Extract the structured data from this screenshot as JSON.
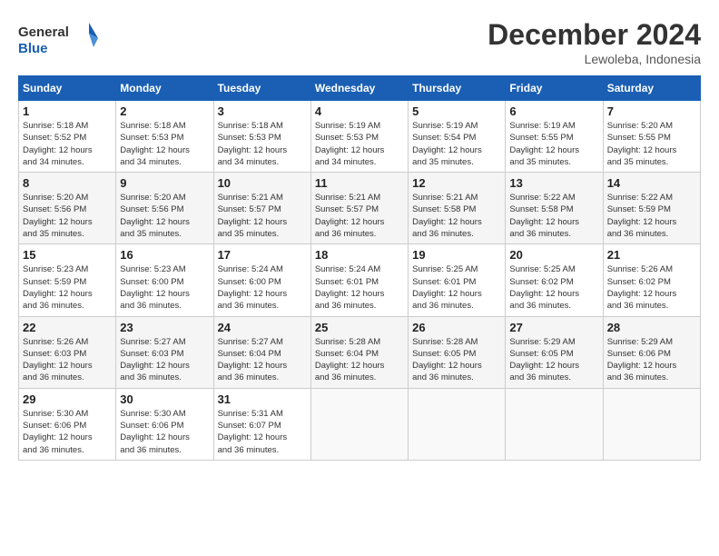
{
  "logo": {
    "line1": "General",
    "line2": "Blue"
  },
  "title": "December 2024",
  "subtitle": "Lewoleba, Indonesia",
  "weekdays": [
    "Sunday",
    "Monday",
    "Tuesday",
    "Wednesday",
    "Thursday",
    "Friday",
    "Saturday"
  ],
  "weeks": [
    [
      {
        "day": 1,
        "info": "Sunrise: 5:18 AM\nSunset: 5:52 PM\nDaylight: 12 hours\nand 34 minutes."
      },
      {
        "day": 2,
        "info": "Sunrise: 5:18 AM\nSunset: 5:53 PM\nDaylight: 12 hours\nand 34 minutes."
      },
      {
        "day": 3,
        "info": "Sunrise: 5:18 AM\nSunset: 5:53 PM\nDaylight: 12 hours\nand 34 minutes."
      },
      {
        "day": 4,
        "info": "Sunrise: 5:19 AM\nSunset: 5:53 PM\nDaylight: 12 hours\nand 34 minutes."
      },
      {
        "day": 5,
        "info": "Sunrise: 5:19 AM\nSunset: 5:54 PM\nDaylight: 12 hours\nand 35 minutes."
      },
      {
        "day": 6,
        "info": "Sunrise: 5:19 AM\nSunset: 5:55 PM\nDaylight: 12 hours\nand 35 minutes."
      },
      {
        "day": 7,
        "info": "Sunrise: 5:20 AM\nSunset: 5:55 PM\nDaylight: 12 hours\nand 35 minutes."
      }
    ],
    [
      {
        "day": 8,
        "info": "Sunrise: 5:20 AM\nSunset: 5:56 PM\nDaylight: 12 hours\nand 35 minutes."
      },
      {
        "day": 9,
        "info": "Sunrise: 5:20 AM\nSunset: 5:56 PM\nDaylight: 12 hours\nand 35 minutes."
      },
      {
        "day": 10,
        "info": "Sunrise: 5:21 AM\nSunset: 5:57 PM\nDaylight: 12 hours\nand 35 minutes."
      },
      {
        "day": 11,
        "info": "Sunrise: 5:21 AM\nSunset: 5:57 PM\nDaylight: 12 hours\nand 36 minutes."
      },
      {
        "day": 12,
        "info": "Sunrise: 5:21 AM\nSunset: 5:58 PM\nDaylight: 12 hours\nand 36 minutes."
      },
      {
        "day": 13,
        "info": "Sunrise: 5:22 AM\nSunset: 5:58 PM\nDaylight: 12 hours\nand 36 minutes."
      },
      {
        "day": 14,
        "info": "Sunrise: 5:22 AM\nSunset: 5:59 PM\nDaylight: 12 hours\nand 36 minutes."
      }
    ],
    [
      {
        "day": 15,
        "info": "Sunrise: 5:23 AM\nSunset: 5:59 PM\nDaylight: 12 hours\nand 36 minutes."
      },
      {
        "day": 16,
        "info": "Sunrise: 5:23 AM\nSunset: 6:00 PM\nDaylight: 12 hours\nand 36 minutes."
      },
      {
        "day": 17,
        "info": "Sunrise: 5:24 AM\nSunset: 6:00 PM\nDaylight: 12 hours\nand 36 minutes."
      },
      {
        "day": 18,
        "info": "Sunrise: 5:24 AM\nSunset: 6:01 PM\nDaylight: 12 hours\nand 36 minutes."
      },
      {
        "day": 19,
        "info": "Sunrise: 5:25 AM\nSunset: 6:01 PM\nDaylight: 12 hours\nand 36 minutes."
      },
      {
        "day": 20,
        "info": "Sunrise: 5:25 AM\nSunset: 6:02 PM\nDaylight: 12 hours\nand 36 minutes."
      },
      {
        "day": 21,
        "info": "Sunrise: 5:26 AM\nSunset: 6:02 PM\nDaylight: 12 hours\nand 36 minutes."
      }
    ],
    [
      {
        "day": 22,
        "info": "Sunrise: 5:26 AM\nSunset: 6:03 PM\nDaylight: 12 hours\nand 36 minutes."
      },
      {
        "day": 23,
        "info": "Sunrise: 5:27 AM\nSunset: 6:03 PM\nDaylight: 12 hours\nand 36 minutes."
      },
      {
        "day": 24,
        "info": "Sunrise: 5:27 AM\nSunset: 6:04 PM\nDaylight: 12 hours\nand 36 minutes."
      },
      {
        "day": 25,
        "info": "Sunrise: 5:28 AM\nSunset: 6:04 PM\nDaylight: 12 hours\nand 36 minutes."
      },
      {
        "day": 26,
        "info": "Sunrise: 5:28 AM\nSunset: 6:05 PM\nDaylight: 12 hours\nand 36 minutes."
      },
      {
        "day": 27,
        "info": "Sunrise: 5:29 AM\nSunset: 6:05 PM\nDaylight: 12 hours\nand 36 minutes."
      },
      {
        "day": 28,
        "info": "Sunrise: 5:29 AM\nSunset: 6:06 PM\nDaylight: 12 hours\nand 36 minutes."
      }
    ],
    [
      {
        "day": 29,
        "info": "Sunrise: 5:30 AM\nSunset: 6:06 PM\nDaylight: 12 hours\nand 36 minutes."
      },
      {
        "day": 30,
        "info": "Sunrise: 5:30 AM\nSunset: 6:06 PM\nDaylight: 12 hours\nand 36 minutes."
      },
      {
        "day": 31,
        "info": "Sunrise: 5:31 AM\nSunset: 6:07 PM\nDaylight: 12 hours\nand 36 minutes."
      },
      null,
      null,
      null,
      null
    ]
  ]
}
